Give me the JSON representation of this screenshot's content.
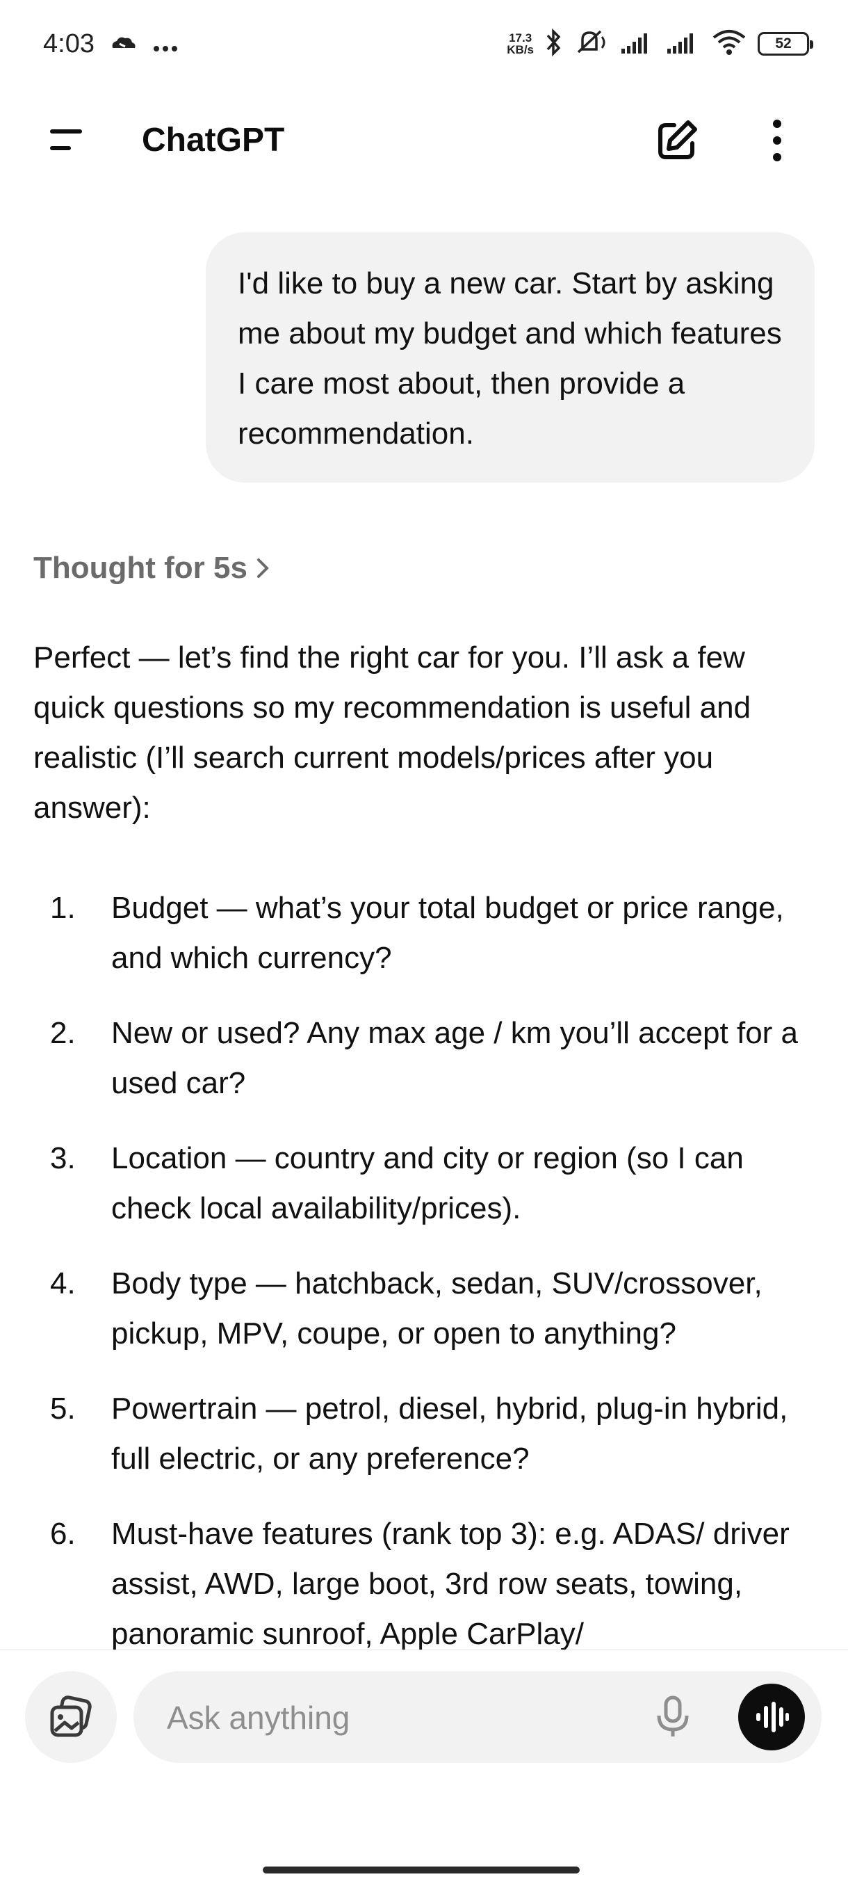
{
  "status_bar": {
    "time": "4:03",
    "net_speed_value": "17.3",
    "net_speed_unit": "KB/s",
    "battery": "52",
    "icons": [
      "weather-icon",
      "more-dots-icon",
      "bluetooth-icon",
      "mute-icon",
      "signal-icon",
      "signal-icon",
      "wifi-icon",
      "battery-icon"
    ]
  },
  "header": {
    "title": "ChatGPT",
    "icons": [
      "menu-icon",
      "compose-icon",
      "more-vertical-icon"
    ]
  },
  "conversation": {
    "user_message": "I'd like to buy a new car. Start by asking me about my budget and which features I care most about, then provide a recommendation.",
    "thought_label": "Thought for 5s",
    "assistant_intro": "Perfect — let’s find the right car for you. I’ll ask a few quick questions so my recommendation is useful and realistic (I’ll search current models/prices after you answer):",
    "questions": [
      {
        "num": "1.",
        "text": "Budget — what’s your total budget or price range, and which currency?"
      },
      {
        "num": "2.",
        "text": "New or used? Any max age / km you’ll accept for a used car?"
      },
      {
        "num": "3.",
        "text": "Location — country and city or region (so I can check local availability/prices)."
      },
      {
        "num": "4.",
        "text": "Body type — hatchback, sedan, SUV/crossover, pickup, MPV, coupe, or open to anything?"
      },
      {
        "num": "5.",
        "text": "Powertrain — petrol, diesel, hybrid, plug-in hybrid, full electric, or any preference?"
      },
      {
        "num": "6.",
        "text": "Must-have features (rank top 3): e.g. ADAS/ driver assist, AWD, large boot, 3rd row seats, towing, panoramic sunroof, Apple CarPlay/"
      }
    ]
  },
  "composer": {
    "placeholder": "Ask anything",
    "icons": [
      "image-attach-icon",
      "microphone-icon",
      "voice-mode-icon"
    ]
  },
  "colors": {
    "bubble_bg": "#f2f2f2",
    "thought_text": "#6b6b6b",
    "placeholder_text": "#8e8e8e",
    "voice_button_bg": "#0d0d0d"
  }
}
